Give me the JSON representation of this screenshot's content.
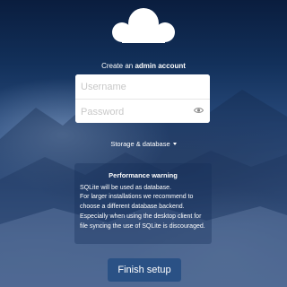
{
  "logo": {
    "icon": "cloud-logo-icon"
  },
  "account": {
    "prefix": "Create an",
    "bold": "admin account"
  },
  "form": {
    "username_placeholder": "Username",
    "password_placeholder": "Password",
    "eye_icon": "eye-icon"
  },
  "storage": {
    "label": "Storage & database",
    "icon": "caret-down-icon"
  },
  "warning": {
    "title": "Performance warning",
    "line1": "SQLite will be used as database.",
    "line2": "For larger installations we recommend to choose a different database backend. Especially when using the desktop client for file syncing the use of SQLite is discouraged."
  },
  "finish": {
    "label": "Finish setup"
  },
  "colors": {
    "button": "#2a5185",
    "background_top": "#0a1d3e",
    "background_bottom": "#6f90c2"
  }
}
